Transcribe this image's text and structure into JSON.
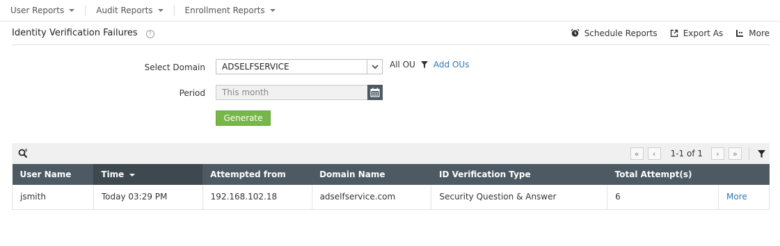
{
  "topnav": {
    "items": [
      {
        "label": "User Reports"
      },
      {
        "label": "Audit Reports"
      },
      {
        "label": "Enrollment Reports"
      }
    ]
  },
  "header": {
    "title": "Identity Verification Failures",
    "help": "?",
    "actions": {
      "schedule": "Schedule Reports",
      "export": "Export As",
      "more": "More"
    }
  },
  "form": {
    "domain_label": "Select Domain",
    "domain_value": "ADSELFSERVICE",
    "ou_label": "All OU",
    "add_ous": "Add OUs",
    "period_label": "Period",
    "period_placeholder": "This month",
    "generate": "Generate"
  },
  "pager": {
    "text": "1-1 of 1"
  },
  "table": {
    "headers": [
      "User Name",
      "Time",
      "Attempted from",
      "Domain Name",
      "ID Verification Type",
      "Total Attempt(s)",
      ""
    ],
    "rows": [
      [
        "jsmith",
        "Today 03:29 PM",
        "192.168.102.18",
        "adselfservice.com",
        "Security Question & Answer",
        "6",
        "More"
      ]
    ]
  },
  "colors": {
    "header_bg": "#4d5a63",
    "accent_green": "#76b747",
    "link_blue": "#2a7ab8"
  }
}
